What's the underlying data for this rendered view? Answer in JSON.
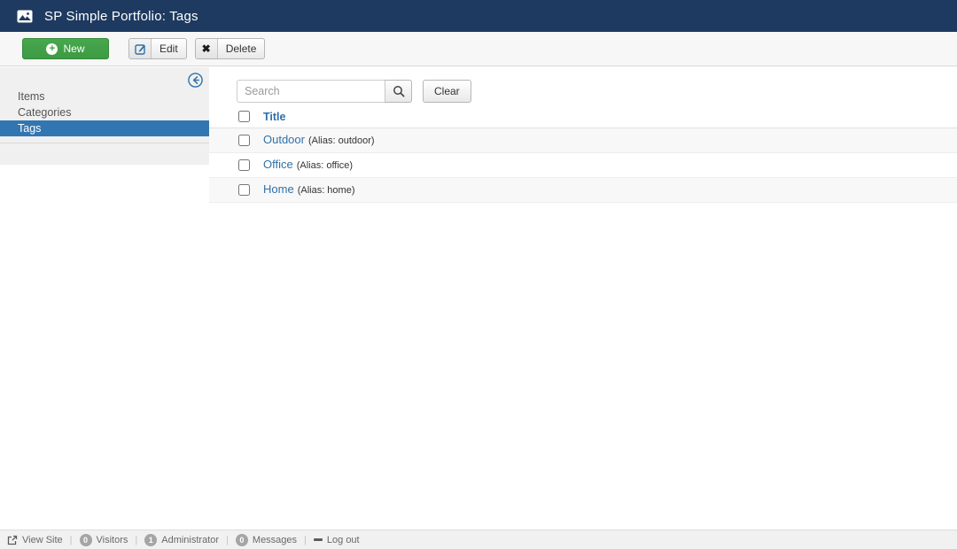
{
  "header": {
    "title": "SP Simple Portfolio: Tags"
  },
  "toolbar": {
    "new_label": "New",
    "edit_label": "Edit",
    "delete_label": "Delete",
    "plus_glyph": "+",
    "delete_glyph": "✖"
  },
  "sidebar": {
    "items": [
      {
        "label": "Items",
        "active": false
      },
      {
        "label": "Categories",
        "active": false
      },
      {
        "label": "Tags",
        "active": true
      }
    ]
  },
  "filters": {
    "search_placeholder": "Search",
    "search_value": "",
    "clear_label": "Clear"
  },
  "table": {
    "title_header": "Title",
    "rows": [
      {
        "title": "Outdoor",
        "alias": "(Alias: outdoor)"
      },
      {
        "title": "Office",
        "alias": "(Alias: office)"
      },
      {
        "title": "Home",
        "alias": "(Alias: home)"
      }
    ]
  },
  "footer": {
    "view_site": "View Site",
    "visitors_count": "0",
    "visitors_label": "Visitors",
    "admin_count": "1",
    "admin_label": "Administrator",
    "messages_count": "0",
    "messages_label": "Messages",
    "logout": "Log out",
    "separator": "|"
  },
  "colors": {
    "header_bg": "#1e3a60",
    "selected_item_bg": "#3276b1",
    "link": "#3071a9",
    "new_button_green": "#3d9a43",
    "sidebar_bg": "#f0f0f0",
    "footer_bg": "#f1f1f1"
  }
}
